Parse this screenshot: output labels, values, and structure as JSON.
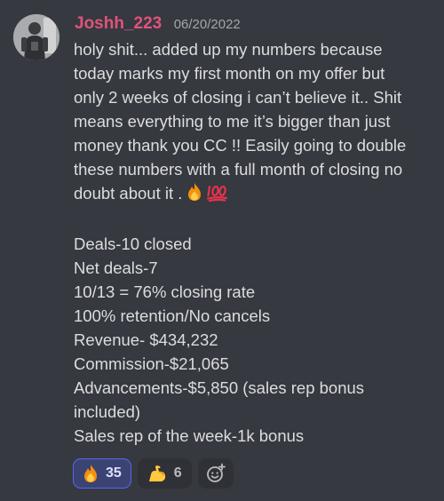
{
  "message": {
    "author": "Joshh_223",
    "timestamp": "06/20/2022",
    "author_color": "#e0537a",
    "avatar_icon": "user-avatar",
    "paragraph_lines": [
      "holy shit... added up my numbers because",
      "today marks my first month on my offer but",
      "only 2 weeks of closing i can’t believe it.. Shit",
      "means everything to me it’s bigger than just",
      "money thank you CC !! Easily going to double",
      "these numbers with a full month of closing no",
      "doubt about it ."
    ],
    "trailing_emojis": [
      "fire-emoji",
      "hundred-points-emoji"
    ],
    "stats": [
      "Deals-10 closed",
      "Net deals-7",
      "10/13 = 76% closing rate",
      "100% retention/No cancels",
      "Revenue- $434,232",
      "Commission-$21,065",
      "Advancements-$5,850 (sales rep bonus included)",
      "Sales rep of the week-1k bonus"
    ]
  },
  "reactions": [
    {
      "emoji": "fire-emoji",
      "count": "35",
      "reacted": true
    },
    {
      "emoji": "flexed-biceps-emoji",
      "count": "6",
      "reacted": false
    }
  ],
  "add_reaction_icon": "add-reaction-icon",
  "colors": {
    "background": "#36393f",
    "text": "#dcddde",
    "timestamp": "#a3a6aa",
    "reaction_active_bg": "#3b4372",
    "reaction_active_border": "#5865f2"
  }
}
